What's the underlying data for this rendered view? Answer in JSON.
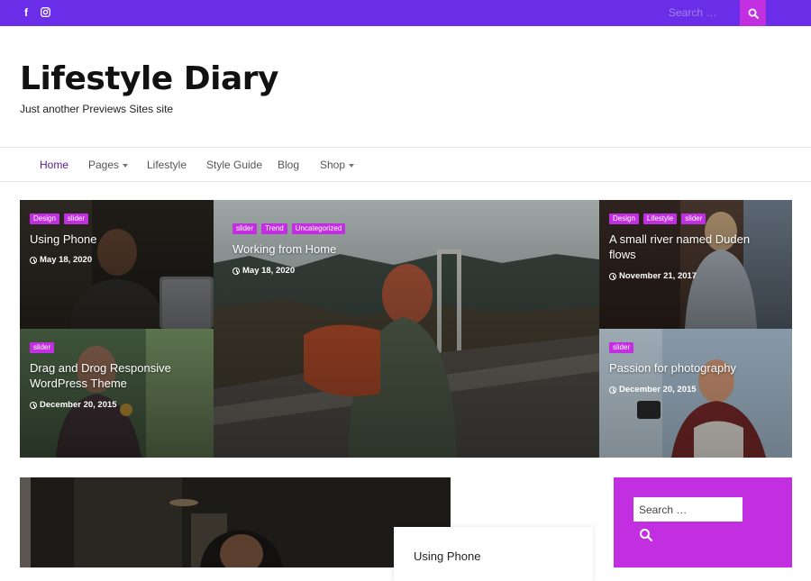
{
  "topbar": {
    "social": [
      {
        "icon": "facebook-icon",
        "glyph": "f"
      },
      {
        "icon": "instagram-icon",
        "glyph": ""
      }
    ],
    "search_placeholder": "Search …",
    "search_button_icon": "search-icon"
  },
  "header": {
    "title": "Lifestyle Diary",
    "tagline": "Just another Previews Sites site"
  },
  "nav": {
    "items": [
      {
        "label": "Home",
        "active": true
      },
      {
        "label": "Pages",
        "has_dropdown": true
      },
      {
        "label": "Lifestyle"
      },
      {
        "label": "Style Guide"
      },
      {
        "label": "Blog"
      },
      {
        "label": "Shop",
        "has_dropdown": true
      }
    ]
  },
  "grid": {
    "posts": [
      {
        "tags": [
          "Design",
          "slider"
        ],
        "title": "Using Phone",
        "date": "May 18, 2020"
      },
      {
        "tags": [
          "slider",
          "Trend",
          "Uncategorized"
        ],
        "title": "Working from Home",
        "date": "May 18, 2020"
      },
      {
        "tags": [
          "Design",
          "Lifestyle",
          "slider"
        ],
        "title_line1": "A small river named Duden",
        "title_line2": "flows",
        "date": "November 21, 2017"
      },
      {
        "tags": [
          "slider"
        ],
        "title_line1": "Drag and Drog Responsive",
        "title_line2": "WordPress Theme",
        "date": "December 20, 2015"
      },
      {
        "tags": [
          "slider"
        ],
        "title": "Passion for photography",
        "date": "December 20, 2015"
      }
    ]
  },
  "featured": {
    "card_title": "Using Phone"
  },
  "sidebar": {
    "search_placeholder": "Search …",
    "search_icon": "search-icon"
  },
  "colors": {
    "topbar": "#6b2ee8",
    "accent": "#c22fe0",
    "nav_active": "#5a1a8a"
  }
}
